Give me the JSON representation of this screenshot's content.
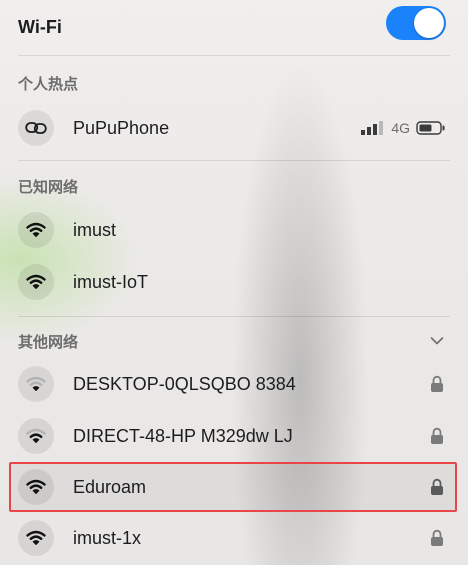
{
  "header": {
    "title": "Wi-Fi",
    "wifi_enabled": true,
    "toggle_color": "#1a82fb"
  },
  "hotspot": {
    "section_label": "个人热点",
    "device": {
      "name": "PuPuPhone",
      "icon": "link-icon",
      "signal_bars": 3,
      "network_type": "4G",
      "battery_icon": "battery-icon"
    }
  },
  "known": {
    "section_label": "已知网络",
    "networks": [
      {
        "name": "imust",
        "icon": "wifi-icon"
      },
      {
        "name": "imust-IoT",
        "icon": "wifi-icon"
      }
    ]
  },
  "other": {
    "section_label": "其他网络",
    "expand_icon": "chevron-down-icon",
    "networks": [
      {
        "name": "DESKTOP-0QLSQBO 8384",
        "icon": "wifi-icon",
        "locked": true
      },
      {
        "name": "DIRECT-48-HP M329dw LJ",
        "icon": "wifi-icon",
        "locked": true
      },
      {
        "name": "Eduroam",
        "icon": "wifi-icon",
        "locked": true,
        "highlighted": true
      },
      {
        "name": "imust-1x",
        "icon": "wifi-icon",
        "locked": true
      }
    ]
  },
  "colors": {
    "highlight_border": "#e8454d",
    "accent": "#1a82fb"
  }
}
